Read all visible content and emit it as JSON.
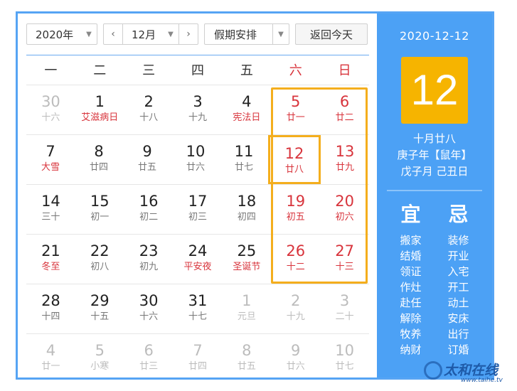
{
  "toolbar": {
    "year": "2020年",
    "month": "12月",
    "prev": "‹",
    "next": "›",
    "holiday": "假期安排",
    "today": "返回今天",
    "caret": "▼"
  },
  "weekdays": [
    "一",
    "二",
    "三",
    "四",
    "五",
    "六",
    "日"
  ],
  "weeks": [
    [
      {
        "d": "30",
        "l": "十六",
        "o": true
      },
      {
        "d": "1",
        "l": "艾滋病日",
        "r": true
      },
      {
        "d": "2",
        "l": "十八"
      },
      {
        "d": "3",
        "l": "十九"
      },
      {
        "d": "4",
        "l": "宪法日",
        "r": true
      },
      {
        "d": "5",
        "l": "廿一",
        "w": true
      },
      {
        "d": "6",
        "l": "廿二",
        "w": true
      }
    ],
    [
      {
        "d": "7",
        "l": "大雪",
        "r": true
      },
      {
        "d": "8",
        "l": "廿四"
      },
      {
        "d": "9",
        "l": "廿五"
      },
      {
        "d": "10",
        "l": "廿六"
      },
      {
        "d": "11",
        "l": "廿七"
      },
      {
        "d": "12",
        "l": "廿八",
        "w": true,
        "s": true
      },
      {
        "d": "13",
        "l": "廿九",
        "w": true
      }
    ],
    [
      {
        "d": "14",
        "l": "三十"
      },
      {
        "d": "15",
        "l": "初一"
      },
      {
        "d": "16",
        "l": "初二"
      },
      {
        "d": "17",
        "l": "初三"
      },
      {
        "d": "18",
        "l": "初四"
      },
      {
        "d": "19",
        "l": "初五",
        "w": true
      },
      {
        "d": "20",
        "l": "初六",
        "w": true
      }
    ],
    [
      {
        "d": "21",
        "l": "冬至",
        "r": true
      },
      {
        "d": "22",
        "l": "初八"
      },
      {
        "d": "23",
        "l": "初九"
      },
      {
        "d": "24",
        "l": "平安夜",
        "r": true
      },
      {
        "d": "25",
        "l": "圣诞节",
        "r": true
      },
      {
        "d": "26",
        "l": "十二",
        "w": true
      },
      {
        "d": "27",
        "l": "十三",
        "w": true
      }
    ],
    [
      {
        "d": "28",
        "l": "十四"
      },
      {
        "d": "29",
        "l": "十五"
      },
      {
        "d": "30",
        "l": "十六"
      },
      {
        "d": "31",
        "l": "十七"
      },
      {
        "d": "1",
        "l": "元旦",
        "o": true
      },
      {
        "d": "2",
        "l": "十九",
        "o": true
      },
      {
        "d": "3",
        "l": "二十",
        "o": true
      }
    ],
    [
      {
        "d": "4",
        "l": "廿一",
        "o": true
      },
      {
        "d": "5",
        "l": "小寒",
        "o": true
      },
      {
        "d": "6",
        "l": "廿三",
        "o": true
      },
      {
        "d": "7",
        "l": "廿四",
        "o": true
      },
      {
        "d": "8",
        "l": "廿五",
        "o": true
      },
      {
        "d": "9",
        "l": "廿六",
        "o": true
      },
      {
        "d": "10",
        "l": "廿七",
        "o": true
      }
    ]
  ],
  "panel": {
    "date": "2020-12-12",
    "day": "12",
    "lunar": "十月廿八",
    "year_gz": "庚子年【鼠年】",
    "month_day_gz": "戊子月 己丑日",
    "yi_title": "宜",
    "ji_title": "忌",
    "yi": [
      "搬家",
      "结婚",
      "领证",
      "作灶",
      "赴任",
      "解除",
      "牧养",
      "纳财"
    ],
    "ji": [
      "装修",
      "开业",
      "入宅",
      "开工",
      "动土",
      "安床",
      "出行",
      "订婚"
    ]
  },
  "watermark": {
    "main": "太和在线",
    "sub": "www.taihe.tv"
  },
  "colors": {
    "accent": "#4ca1f5",
    "highlight": "#f6b400",
    "weekend": "#d8343c"
  }
}
